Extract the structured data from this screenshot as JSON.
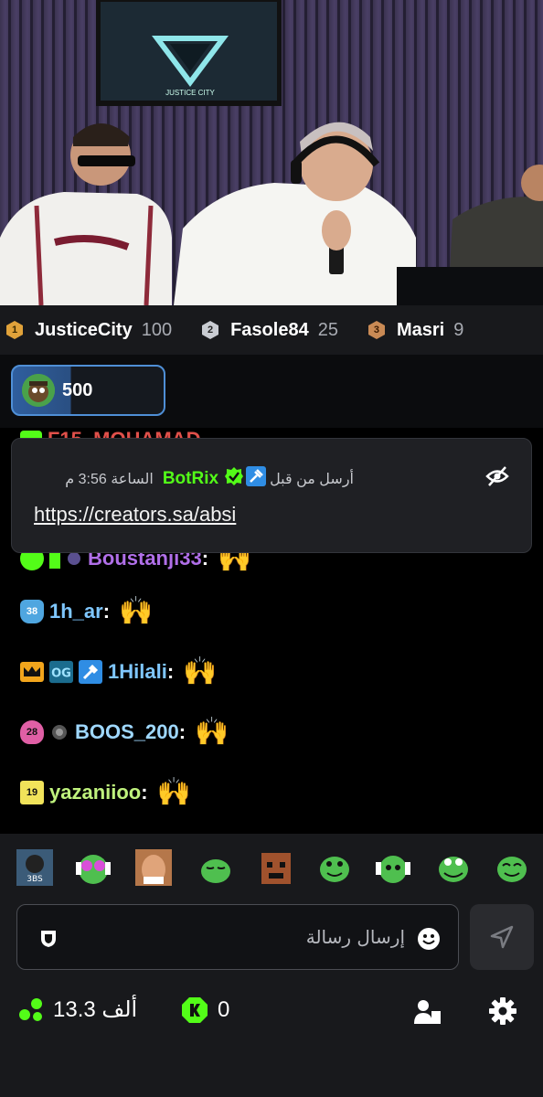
{
  "stream": {
    "screen_logo_text": "JUSTICE CITY"
  },
  "leaderboard": [
    {
      "rank": "1",
      "name": "JusticeCity",
      "score": "100",
      "color": "#e0a23a"
    },
    {
      "rank": "2",
      "name": "Fasole84",
      "score": "25",
      "color": "#c9ccd2"
    },
    {
      "rank": "3",
      "name": "Masri",
      "score": "9",
      "color": "#c98a55"
    }
  ],
  "gift": {
    "amount": "500"
  },
  "pinned": {
    "sender": "BotRix",
    "label": "أرسل من قبل",
    "time": "الساعة 3:56 م",
    "link": "https://creators.sa/absi"
  },
  "chat": [
    {
      "badge": "",
      "username": "Boustanji33",
      "name_color": "#b06fe8",
      "emote": "🙌"
    },
    {
      "badge": "38",
      "badge_color": "#4fa6e0",
      "username": "1h_ar",
      "name_color": "#7fc7ff",
      "emote": "🙌"
    },
    {
      "badge": "",
      "username": "1Hilali",
      "name_color": "#7fc7ff",
      "emote": "🙌"
    },
    {
      "badge": "28",
      "badge_color": "#e05fa5",
      "username": "BOOS_200",
      "name_color": "#9fd8ff",
      "emote": "🙌"
    },
    {
      "badge": "19",
      "badge_color": "#f1e35a",
      "username": "yazaniioo",
      "name_color": "#bff27d",
      "emote": "🙌"
    }
  ],
  "hidden_row": {
    "username": "F15_MOHAMAD"
  },
  "emotes": [
    "3BS",
    "frog-headphones",
    "meme-face",
    "frog-sleepy",
    "mad-block",
    "frog-smile",
    "frog-headphones-2",
    "frog-grin",
    "frog-happy"
  ],
  "input": {
    "placeholder": "إرسال رسالة"
  },
  "stats": {
    "viewers": "13.3 ألف",
    "kicks": "0"
  },
  "colors": {
    "accent": "#53fc18",
    "verified": "#53fc18",
    "mod": "#2f8de4"
  }
}
